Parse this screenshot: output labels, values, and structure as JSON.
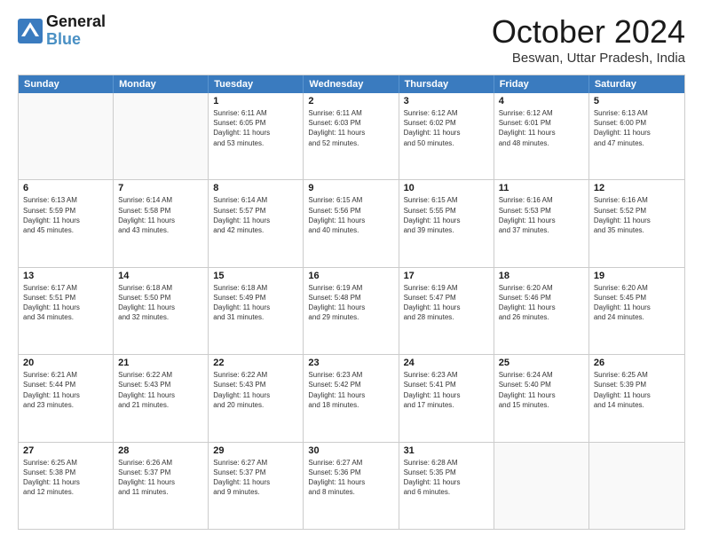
{
  "header": {
    "logo_line1": "General",
    "logo_line2": "Blue",
    "month_title": "October 2024",
    "location": "Beswan, Uttar Pradesh, India"
  },
  "days_of_week": [
    "Sunday",
    "Monday",
    "Tuesday",
    "Wednesday",
    "Thursday",
    "Friday",
    "Saturday"
  ],
  "weeks": [
    [
      {
        "day": "",
        "sunrise": "",
        "sunset": "",
        "daylight": ""
      },
      {
        "day": "",
        "sunrise": "",
        "sunset": "",
        "daylight": ""
      },
      {
        "day": "1",
        "sunrise": "Sunrise: 6:11 AM",
        "sunset": "Sunset: 6:05 PM",
        "daylight": "Daylight: 11 hours and 53 minutes."
      },
      {
        "day": "2",
        "sunrise": "Sunrise: 6:11 AM",
        "sunset": "Sunset: 6:03 PM",
        "daylight": "Daylight: 11 hours and 52 minutes."
      },
      {
        "day": "3",
        "sunrise": "Sunrise: 6:12 AM",
        "sunset": "Sunset: 6:02 PM",
        "daylight": "Daylight: 11 hours and 50 minutes."
      },
      {
        "day": "4",
        "sunrise": "Sunrise: 6:12 AM",
        "sunset": "Sunset: 6:01 PM",
        "daylight": "Daylight: 11 hours and 48 minutes."
      },
      {
        "day": "5",
        "sunrise": "Sunrise: 6:13 AM",
        "sunset": "Sunset: 6:00 PM",
        "daylight": "Daylight: 11 hours and 47 minutes."
      }
    ],
    [
      {
        "day": "6",
        "sunrise": "Sunrise: 6:13 AM",
        "sunset": "Sunset: 5:59 PM",
        "daylight": "Daylight: 11 hours and 45 minutes."
      },
      {
        "day": "7",
        "sunrise": "Sunrise: 6:14 AM",
        "sunset": "Sunset: 5:58 PM",
        "daylight": "Daylight: 11 hours and 43 minutes."
      },
      {
        "day": "8",
        "sunrise": "Sunrise: 6:14 AM",
        "sunset": "Sunset: 5:57 PM",
        "daylight": "Daylight: 11 hours and 42 minutes."
      },
      {
        "day": "9",
        "sunrise": "Sunrise: 6:15 AM",
        "sunset": "Sunset: 5:56 PM",
        "daylight": "Daylight: 11 hours and 40 minutes."
      },
      {
        "day": "10",
        "sunrise": "Sunrise: 6:15 AM",
        "sunset": "Sunset: 5:55 PM",
        "daylight": "Daylight: 11 hours and 39 minutes."
      },
      {
        "day": "11",
        "sunrise": "Sunrise: 6:16 AM",
        "sunset": "Sunset: 5:53 PM",
        "daylight": "Daylight: 11 hours and 37 minutes."
      },
      {
        "day": "12",
        "sunrise": "Sunrise: 6:16 AM",
        "sunset": "Sunset: 5:52 PM",
        "daylight": "Daylight: 11 hours and 35 minutes."
      }
    ],
    [
      {
        "day": "13",
        "sunrise": "Sunrise: 6:17 AM",
        "sunset": "Sunset: 5:51 PM",
        "daylight": "Daylight: 11 hours and 34 minutes."
      },
      {
        "day": "14",
        "sunrise": "Sunrise: 6:18 AM",
        "sunset": "Sunset: 5:50 PM",
        "daylight": "Daylight: 11 hours and 32 minutes."
      },
      {
        "day": "15",
        "sunrise": "Sunrise: 6:18 AM",
        "sunset": "Sunset: 5:49 PM",
        "daylight": "Daylight: 11 hours and 31 minutes."
      },
      {
        "day": "16",
        "sunrise": "Sunrise: 6:19 AM",
        "sunset": "Sunset: 5:48 PM",
        "daylight": "Daylight: 11 hours and 29 minutes."
      },
      {
        "day": "17",
        "sunrise": "Sunrise: 6:19 AM",
        "sunset": "Sunset: 5:47 PM",
        "daylight": "Daylight: 11 hours and 28 minutes."
      },
      {
        "day": "18",
        "sunrise": "Sunrise: 6:20 AM",
        "sunset": "Sunset: 5:46 PM",
        "daylight": "Daylight: 11 hours and 26 minutes."
      },
      {
        "day": "19",
        "sunrise": "Sunrise: 6:20 AM",
        "sunset": "Sunset: 5:45 PM",
        "daylight": "Daylight: 11 hours and 24 minutes."
      }
    ],
    [
      {
        "day": "20",
        "sunrise": "Sunrise: 6:21 AM",
        "sunset": "Sunset: 5:44 PM",
        "daylight": "Daylight: 11 hours and 23 minutes."
      },
      {
        "day": "21",
        "sunrise": "Sunrise: 6:22 AM",
        "sunset": "Sunset: 5:43 PM",
        "daylight": "Daylight: 11 hours and 21 minutes."
      },
      {
        "day": "22",
        "sunrise": "Sunrise: 6:22 AM",
        "sunset": "Sunset: 5:43 PM",
        "daylight": "Daylight: 11 hours and 20 minutes."
      },
      {
        "day": "23",
        "sunrise": "Sunrise: 6:23 AM",
        "sunset": "Sunset: 5:42 PM",
        "daylight": "Daylight: 11 hours and 18 minutes."
      },
      {
        "day": "24",
        "sunrise": "Sunrise: 6:23 AM",
        "sunset": "Sunset: 5:41 PM",
        "daylight": "Daylight: 11 hours and 17 minutes."
      },
      {
        "day": "25",
        "sunrise": "Sunrise: 6:24 AM",
        "sunset": "Sunset: 5:40 PM",
        "daylight": "Daylight: 11 hours and 15 minutes."
      },
      {
        "day": "26",
        "sunrise": "Sunrise: 6:25 AM",
        "sunset": "Sunset: 5:39 PM",
        "daylight": "Daylight: 11 hours and 14 minutes."
      }
    ],
    [
      {
        "day": "27",
        "sunrise": "Sunrise: 6:25 AM",
        "sunset": "Sunset: 5:38 PM",
        "daylight": "Daylight: 11 hours and 12 minutes."
      },
      {
        "day": "28",
        "sunrise": "Sunrise: 6:26 AM",
        "sunset": "Sunset: 5:37 PM",
        "daylight": "Daylight: 11 hours and 11 minutes."
      },
      {
        "day": "29",
        "sunrise": "Sunrise: 6:27 AM",
        "sunset": "Sunset: 5:37 PM",
        "daylight": "Daylight: 11 hours and 9 minutes."
      },
      {
        "day": "30",
        "sunrise": "Sunrise: 6:27 AM",
        "sunset": "Sunset: 5:36 PM",
        "daylight": "Daylight: 11 hours and 8 minutes."
      },
      {
        "day": "31",
        "sunrise": "Sunrise: 6:28 AM",
        "sunset": "Sunset: 5:35 PM",
        "daylight": "Daylight: 11 hours and 6 minutes."
      },
      {
        "day": "",
        "sunrise": "",
        "sunset": "",
        "daylight": ""
      },
      {
        "day": "",
        "sunrise": "",
        "sunset": "",
        "daylight": ""
      }
    ]
  ]
}
